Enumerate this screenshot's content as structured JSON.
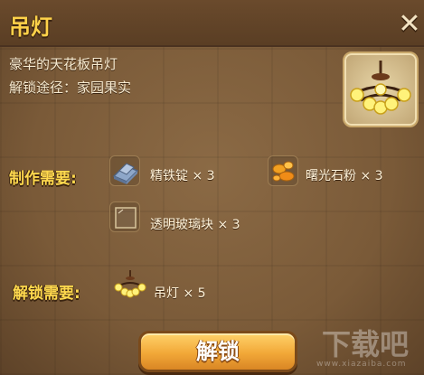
{
  "window": {
    "title": "吊灯",
    "close_icon": "close-icon"
  },
  "item": {
    "description": "豪华的天花板吊灯",
    "unlock_source": "解锁途径：家园果实",
    "preview_icon": "chandelier-icon"
  },
  "crafting": {
    "label": "制作需要:",
    "materials": [
      {
        "name": "精铁锭 × 3",
        "icon": "iron-ingot-icon",
        "color": "#8ea7c9"
      },
      {
        "name": "曙光石粉 × 3",
        "icon": "dawn-stone-powder-icon",
        "color": "#f2a021"
      },
      {
        "name": "透明玻璃块 × 3",
        "icon": "transparent-glass-block-icon",
        "color": "#e9dcc0"
      }
    ]
  },
  "unlock_requirements": {
    "label": "解锁需要:",
    "items": [
      {
        "name": "吊灯 × 5",
        "icon": "chandelier-icon"
      }
    ]
  },
  "actions": {
    "unlock_label": "解锁"
  },
  "colors": {
    "title": "#ffd24a",
    "section_label": "#ffd94e",
    "button_top": "#ffd36a",
    "button_bottom": "#d98624"
  }
}
